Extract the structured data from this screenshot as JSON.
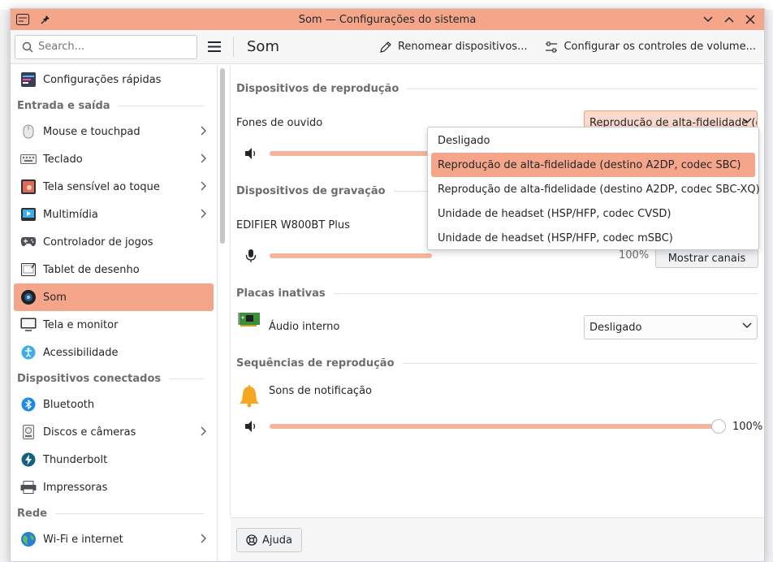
{
  "window": {
    "title": "Som — Configurações do sistema"
  },
  "toolbar": {
    "search_placeholder": "Search...",
    "page_title": "Som",
    "rename_label": "Renomear dispositivos...",
    "configure_label": "Configurar os controles de volume..."
  },
  "sidebar": {
    "quick_settings": "Configurações rápidas",
    "group_io": "Entrada e saída",
    "mouse": "Mouse e touchpad",
    "keyboard": "Teclado",
    "touchscreen": "Tela sensível ao toque",
    "multimedia": "Multimídia",
    "game_controller": "Controlador de jogos",
    "drawing_tablet": "Tablet de desenho",
    "sound": "Som",
    "display": "Tela e monitor",
    "accessibility": "Acessibilidade",
    "group_connected": "Dispositivos conectados",
    "bluetooth": "Bluetooth",
    "disks": "Discos e câmeras",
    "thunderbolt": "Thunderbolt",
    "printers": "Impressoras",
    "group_network": "Rede",
    "wifi": "Wi-Fi e internet"
  },
  "content": {
    "playback_header": "Dispositivos de reprodução",
    "headphones_label": "Fones de ouvido",
    "headphones_profile": "Reprodução de alta-fidelidade (destino  A2DP, codec SBC)",
    "recording_header": "Dispositivos de gravação",
    "recording_device": "EDIFIER W800BT Plus",
    "recording_percent": "100%",
    "show_channels": "Mostrar canais",
    "inactive_header": "Placas inativas",
    "internal_audio": "Áudio interno",
    "internal_profile": "Desligado",
    "streams_header": "Sequências de reprodução",
    "notification_sounds": "Sons de notificação",
    "notification_volume": 100,
    "notification_percent": "100%"
  },
  "dropdown": {
    "options": [
      "Desligado",
      "Reprodução de alta-fidelidade (destino  A2DP, codec SBC)",
      "Reprodução de alta-fidelidade (destino  A2DP, codec SBC-XQ)",
      "Unidade de headset (HSP/HFP, codec CVSD)",
      "Unidade de headset (HSP/HFP, codec mSBC)"
    ],
    "selected_index": 1
  },
  "footer": {
    "help_label": "Ajuda"
  },
  "colors": {
    "accent": "#f5a68a",
    "slider": "#f5b49c"
  }
}
